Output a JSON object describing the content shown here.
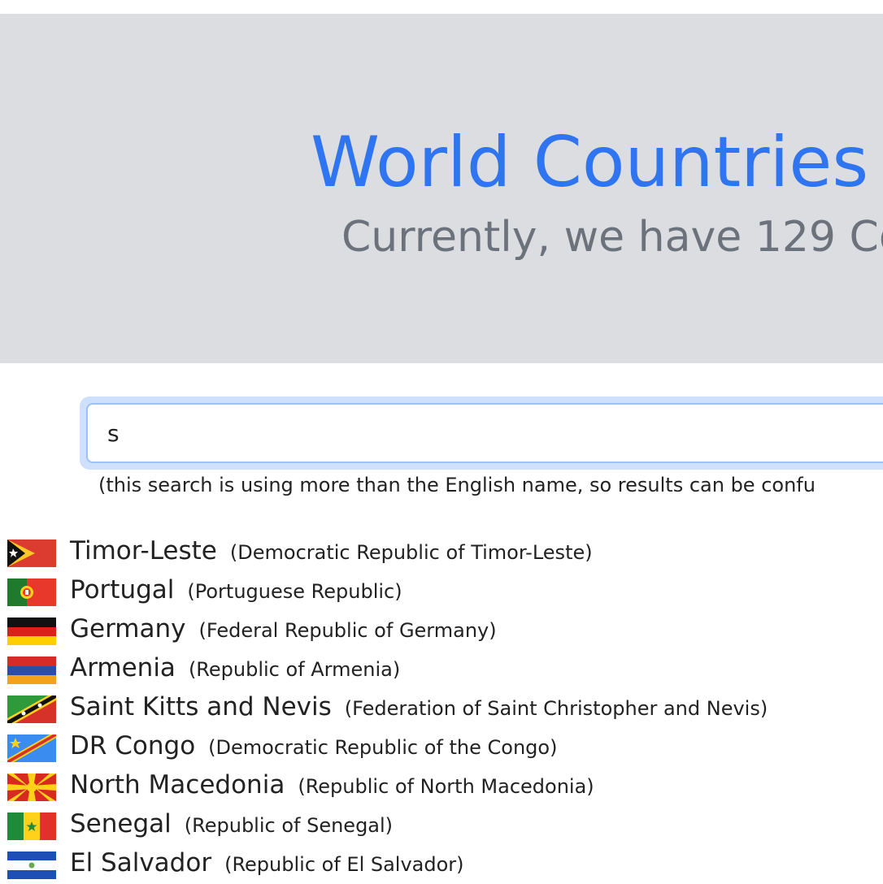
{
  "header": {
    "title": "World Countries",
    "subtitle": "Currently, we have 129 Co"
  },
  "search": {
    "value": "s",
    "note": "(this search is using more than the English name, so results can be confu"
  },
  "countries": [
    {
      "name": "Timor-Leste",
      "official": "(Democratic Republic of Timor-Leste)",
      "flag_icon": "timor-leste-flag-icon"
    },
    {
      "name": "Portugal",
      "official": "(Portuguese Republic)",
      "flag_icon": "portugal-flag-icon"
    },
    {
      "name": "Germany",
      "official": "(Federal Republic of Germany)",
      "flag_icon": "germany-flag-icon"
    },
    {
      "name": "Armenia",
      "official": "(Republic of Armenia)",
      "flag_icon": "armenia-flag-icon"
    },
    {
      "name": "Saint Kitts and Nevis",
      "official": "(Federation of Saint Christopher and Nevis)",
      "flag_icon": "saint-kitts-and-nevis-flag-icon"
    },
    {
      "name": "DR Congo",
      "official": "(Democratic Republic of the Congo)",
      "flag_icon": "dr-congo-flag-icon"
    },
    {
      "name": "North Macedonia",
      "official": "(Republic of North Macedonia)",
      "flag_icon": "north-macedonia-flag-icon"
    },
    {
      "name": "Senegal",
      "official": "(Republic of Senegal)",
      "flag_icon": "senegal-flag-icon"
    },
    {
      "name": "El Salvador",
      "official": "(Republic of El Salvador)",
      "flag_icon": "el-salvador-flag-icon"
    }
  ],
  "colors": {
    "title": "#2f74f0",
    "subtitle": "#6b727b",
    "hero_background": "#dcdde0",
    "search_focus": "#9cc0f7"
  }
}
